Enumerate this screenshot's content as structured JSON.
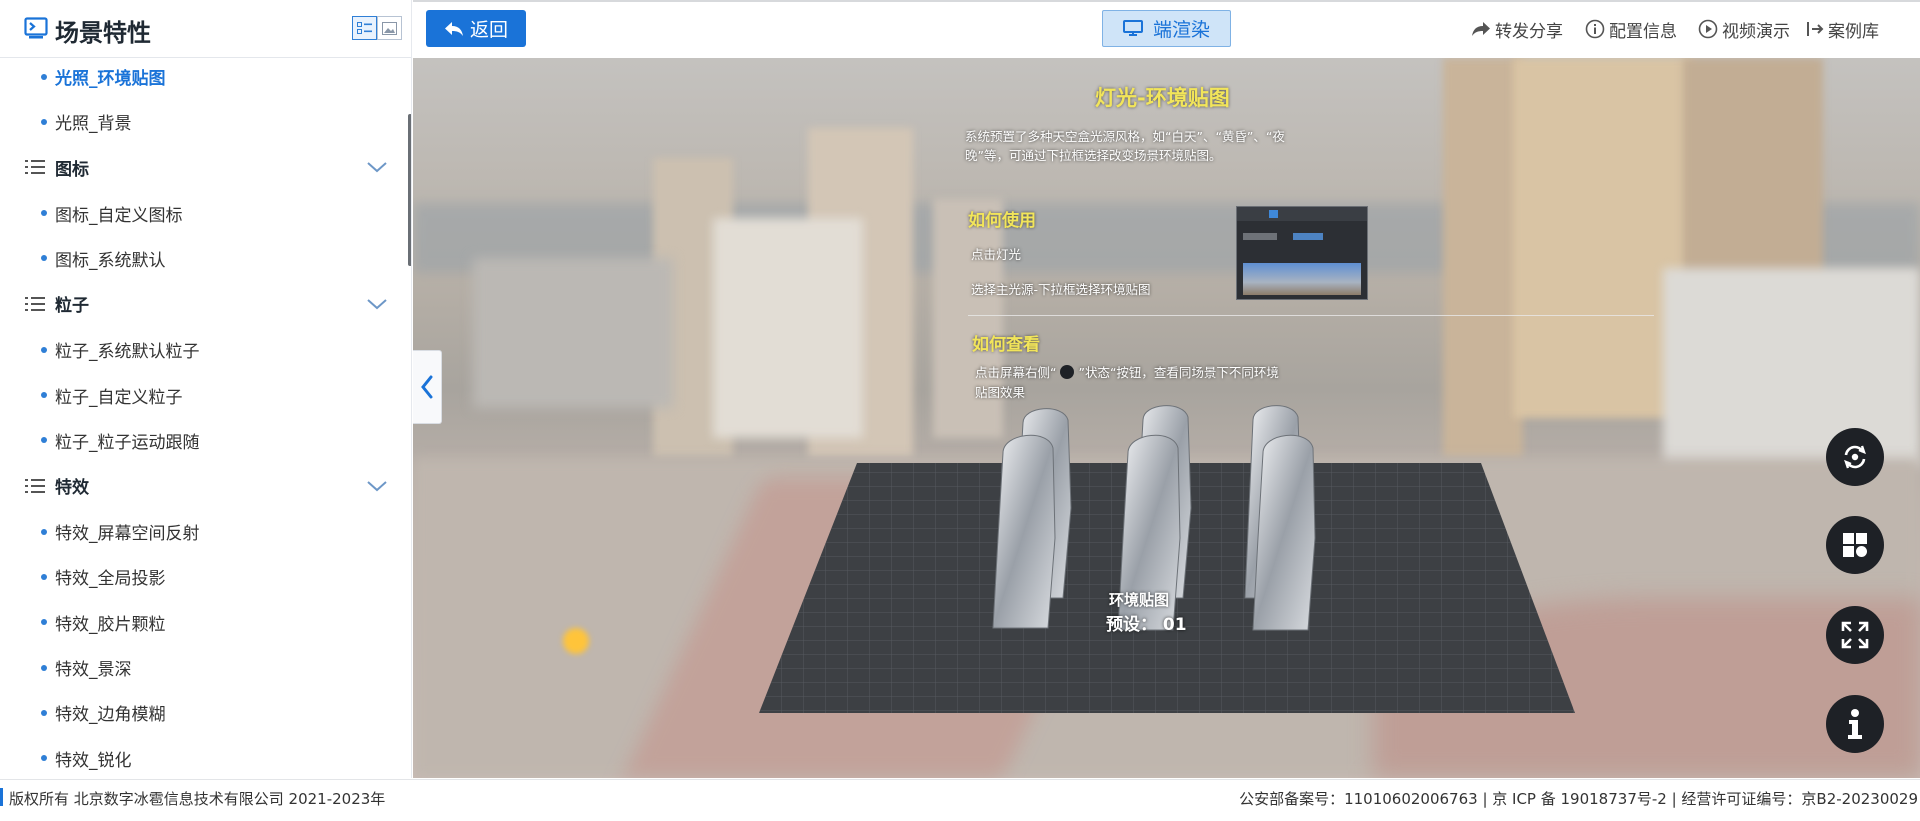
{
  "sidebar": {
    "title": "场景特性",
    "items": [
      {
        "type": "item",
        "label": "光照_环境贴图",
        "active": true
      },
      {
        "type": "item",
        "label": "光照_背景"
      },
      {
        "type": "group",
        "label": "图标"
      },
      {
        "type": "item",
        "label": "图标_自定义图标"
      },
      {
        "type": "item",
        "label": "图标_系统默认"
      },
      {
        "type": "group",
        "label": "粒子"
      },
      {
        "type": "item",
        "label": "粒子_系统默认粒子"
      },
      {
        "type": "item",
        "label": "粒子_自定义粒子"
      },
      {
        "type": "item",
        "label": "粒子_粒子运动跟随"
      },
      {
        "type": "group",
        "label": "特效"
      },
      {
        "type": "item",
        "label": "特效_屏幕空间反射"
      },
      {
        "type": "item",
        "label": "特效_全局投影"
      },
      {
        "type": "item",
        "label": "特效_胶片颗粒"
      },
      {
        "type": "item",
        "label": "特效_景深"
      },
      {
        "type": "item",
        "label": "特效_边角模糊"
      },
      {
        "type": "item",
        "label": "特效_锐化"
      }
    ]
  },
  "toolbar": {
    "back_label": "返回",
    "render_label": "端渲染",
    "links": {
      "share": "转发分享",
      "config": "配置信息",
      "video": "视频演示",
      "cases": "案例库"
    }
  },
  "scene": {
    "title": "灯光-环境贴图",
    "description_line1": "系统预置了多种天空盒光源风格，如“白天”、“黄昏”、“夜",
    "description_line2": "晚”等，可通过下拉框选择改变场景环境贴图。",
    "how_to_use": "如何使用",
    "step1": "点击灯光",
    "step2": "选择主光源-下拉框选择环境贴图",
    "how_to_view": "如何查看",
    "view_line1_a": "点击屏幕右侧“",
    "view_line1_b": "”状态“按钮，查看同场景下不同环境",
    "view_line2": "贴图效果",
    "floor_label": "环境贴图",
    "preset_label": "预设： 01"
  },
  "footer": {
    "copyright": "版权所有 北京数字冰雹信息技术有限公司 2021-2023年",
    "beian": "公安部备案号：11010602006763 | 京 ICP 备 19018737号-2 | 经营许可证编号：京B2-20230029"
  },
  "colors": {
    "accent": "#1a73d8",
    "round_button": "#1e2126",
    "scene_heading": "#f2e55a"
  }
}
